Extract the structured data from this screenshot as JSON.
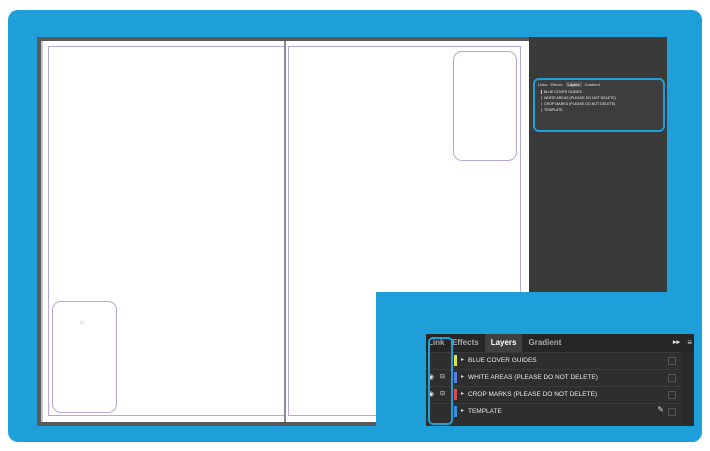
{
  "colors": {
    "accent_blue": "#1e9fd9",
    "guides_yellow": "#e4e24a",
    "white_areas_blue": "#5b7fd6",
    "crop_marks_red": "#e04a4a",
    "template_blue": "#3f8fe0"
  },
  "canvas": {
    "x_mark": "×"
  },
  "layers_panel_small": {
    "tabs": [
      "Links",
      "Effects",
      "Layers",
      "Gradient"
    ],
    "layers": [
      {
        "name": "BLUE COVER GUIDES"
      },
      {
        "name": "WHITE AREAS (PLEASE DO NOT DELETE)"
      },
      {
        "name": "CROP MARKS (PLEASE DO NOT DELETE)"
      },
      {
        "name": "TEMPLATE"
      }
    ]
  },
  "layers_panel_zoom": {
    "tab_link": "Link",
    "tab_effects": "Effects",
    "tab_layers": "Layers",
    "tab_gradient": "Gradient",
    "menu_arrows": "▸▸",
    "menu_icon": "≡",
    "layer_1": "BLUE COVER GUIDES",
    "layer_2": "WHITE AREAS (PLEASE DO NOT DELETE)",
    "layer_3": "CROP MARKS (PLEASE DO NOT DELETE)",
    "layer_4": "TEMPLATE",
    "eye_icon": "◉",
    "lock_icon": "⊟",
    "expand_icon": "▸",
    "pen_icon": "✎"
  }
}
